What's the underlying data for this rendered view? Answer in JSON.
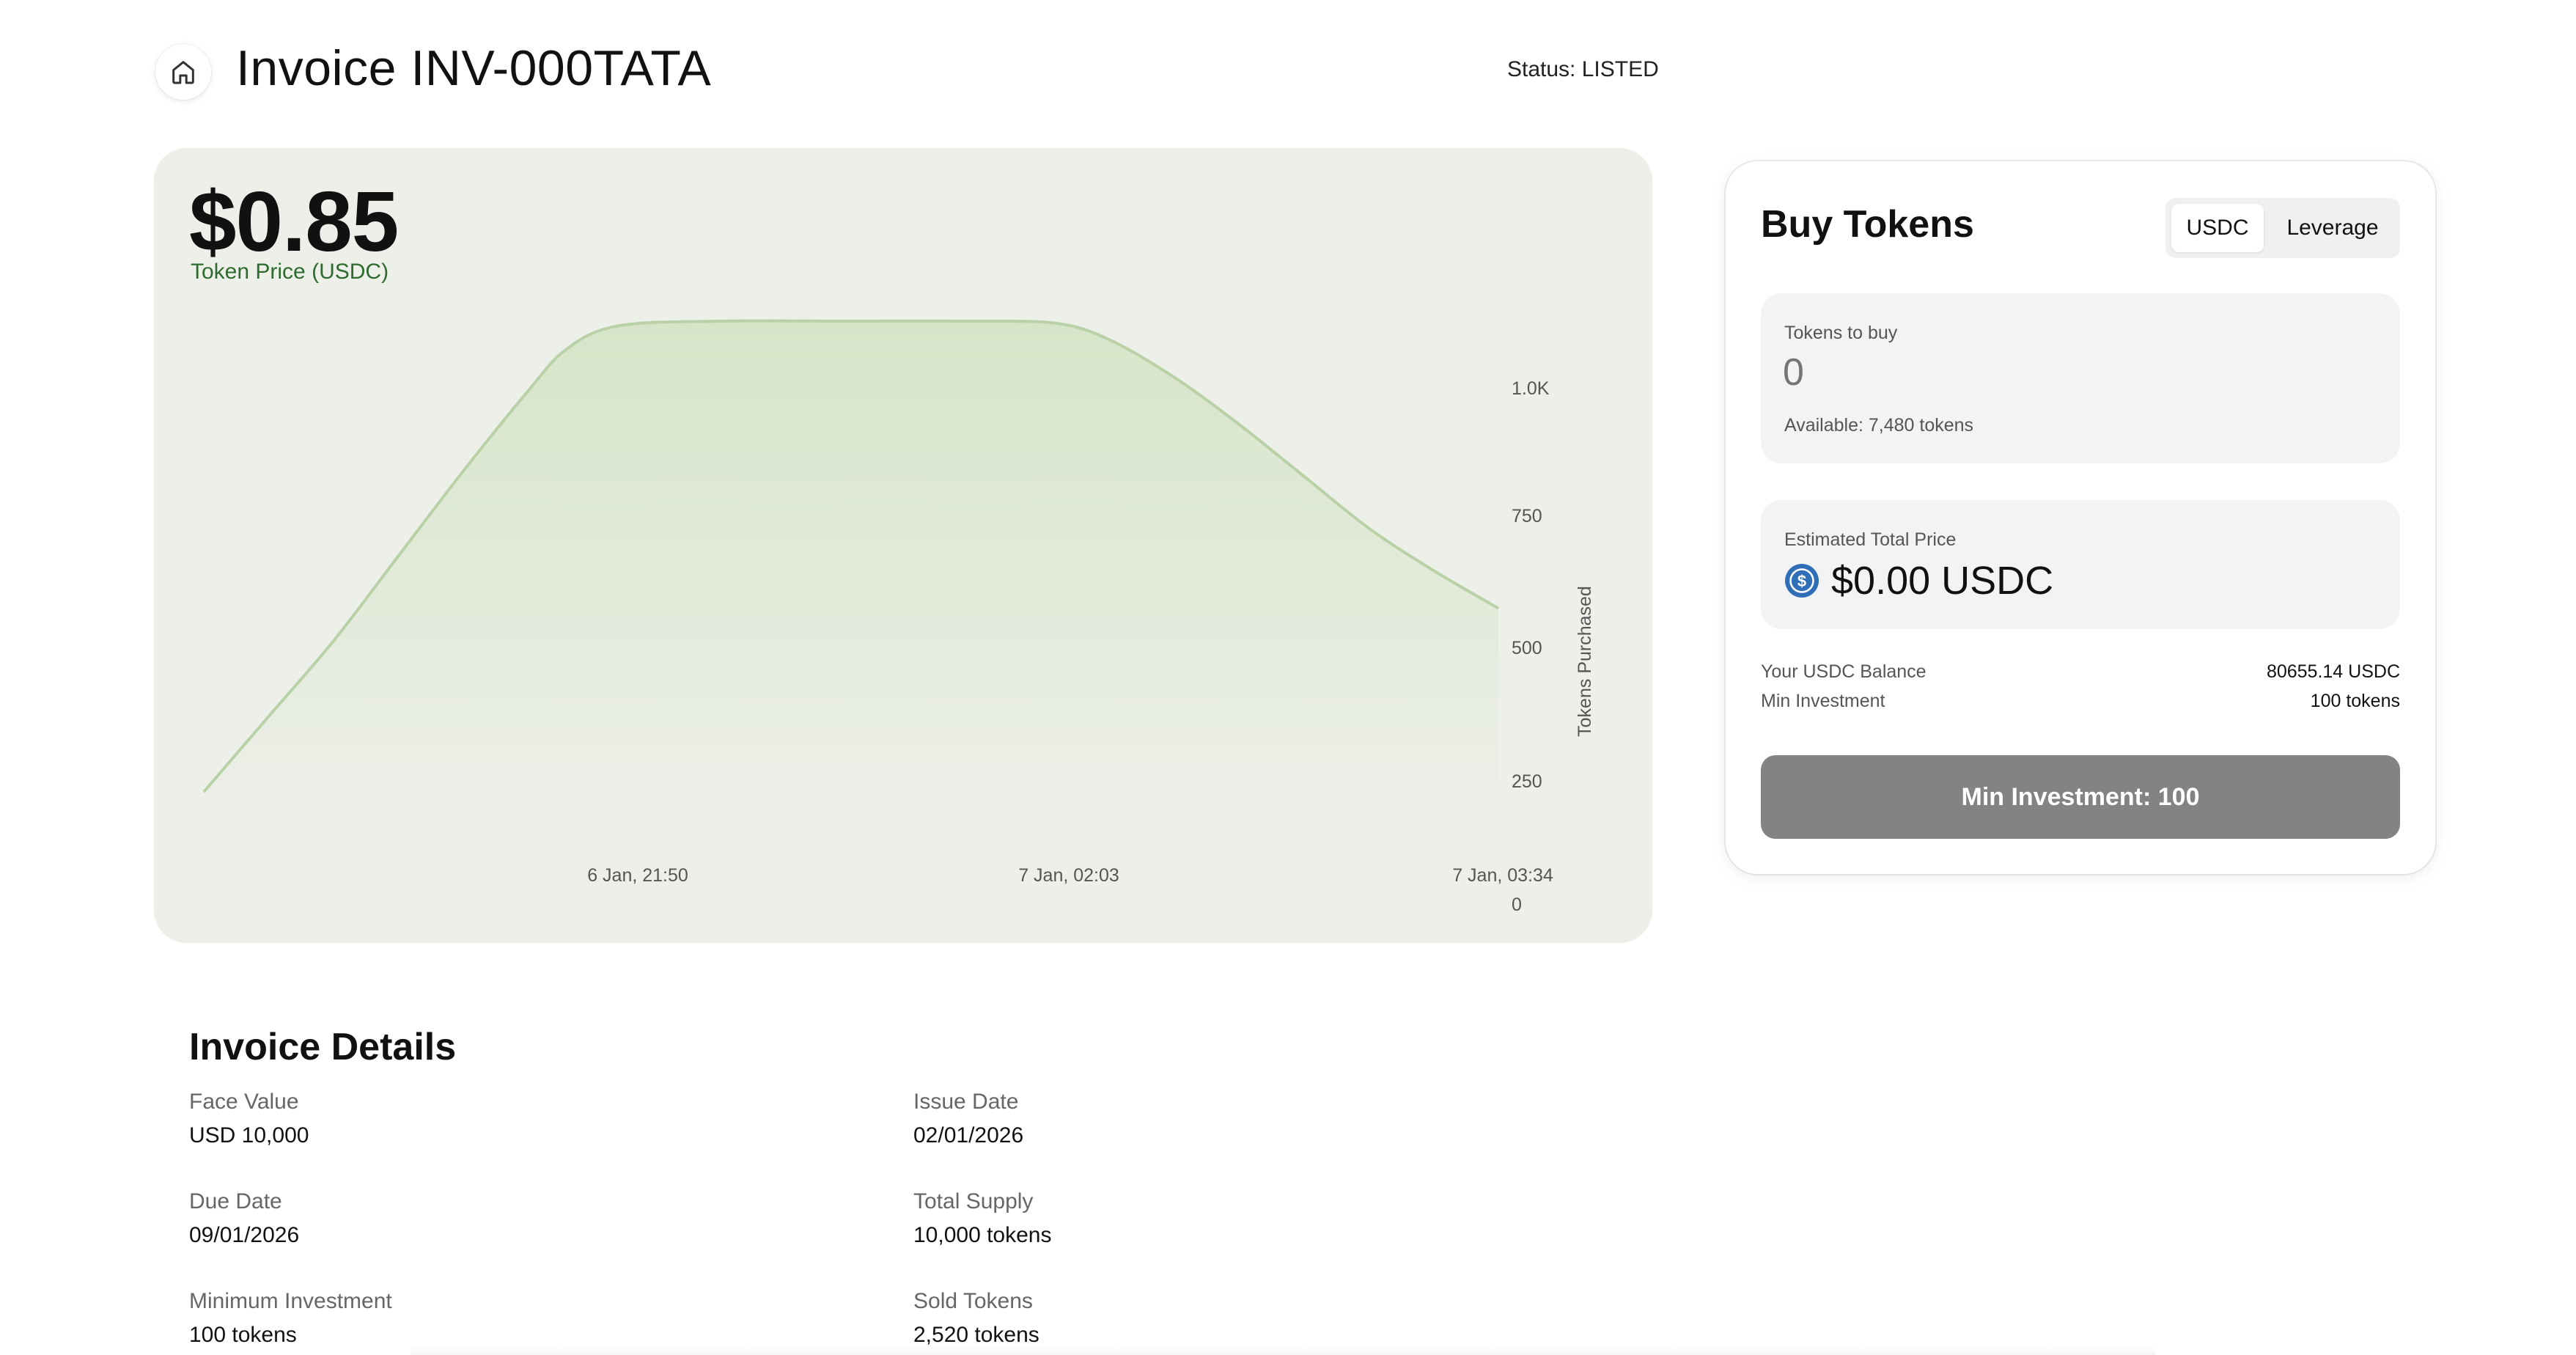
{
  "header": {
    "home_icon": "home-icon",
    "title": "Invoice INV-000TATA",
    "status": "Status: LISTED"
  },
  "price_card": {
    "price": "$0.85",
    "price_label": "Token Price (USDC)"
  },
  "chart_data": {
    "type": "area",
    "ylabel": "Tokens Purchased",
    "y_ticks": [
      "0",
      "250",
      "500",
      "750",
      "1.0K"
    ],
    "ylim": [
      0,
      1000
    ],
    "x_ticks": [
      "6 Jan, 21:50",
      "7 Jan, 02:03",
      "7 Jan, 03:34"
    ],
    "series": [
      {
        "x": [
          0,
          0.05,
          0.1,
          0.15,
          0.2,
          0.25,
          0.28,
          0.32,
          0.4,
          0.5,
          0.6,
          0.66,
          0.7,
          0.75,
          0.8,
          0.85,
          0.9,
          0.95,
          1.0
        ],
        "values": [
          0,
          160,
          320,
          500,
          680,
          850,
          940,
          990,
          1000,
          1000,
          1000,
          995,
          960,
          880,
          780,
          670,
          560,
          470,
          390
        ]
      }
    ],
    "colors": {
      "line": "#b9d1a7",
      "fill_top": "#d6e5c8",
      "fill_bottom": "#edefe9"
    },
    "grid": false
  },
  "buy": {
    "title": "Buy Tokens",
    "tabs": [
      "USDC",
      "Leverage"
    ],
    "active_tab": "USDC",
    "tokens_label": "Tokens to buy",
    "tokens_placeholder": "0",
    "available": "Available: 7,480 tokens",
    "est_label": "Estimated Total Price",
    "est_icon": "usdc-coin-icon",
    "est_value": "$0.00 USDC",
    "balance_label": "Your USDC Balance",
    "balance_value": "80655.14 USDC",
    "min_label": "Min Investment",
    "min_value": "100 tokens",
    "cta": "Min Investment: 100"
  },
  "details": {
    "title": "Invoice Details",
    "face_value_label": "Face Value",
    "face_value": "USD 10,000",
    "issue_date_label": "Issue Date",
    "issue_date": "02/01/2026",
    "due_date_label": "Due Date",
    "due_date": "09/01/2026",
    "total_supply_label": "Total Supply",
    "total_supply": "10,000 tokens",
    "min_inv_label": "Minimum Investment",
    "min_inv": "100 tokens",
    "sold_label": "Sold Tokens",
    "sold": "2,520 tokens"
  },
  "accent": "#2f6b2f"
}
